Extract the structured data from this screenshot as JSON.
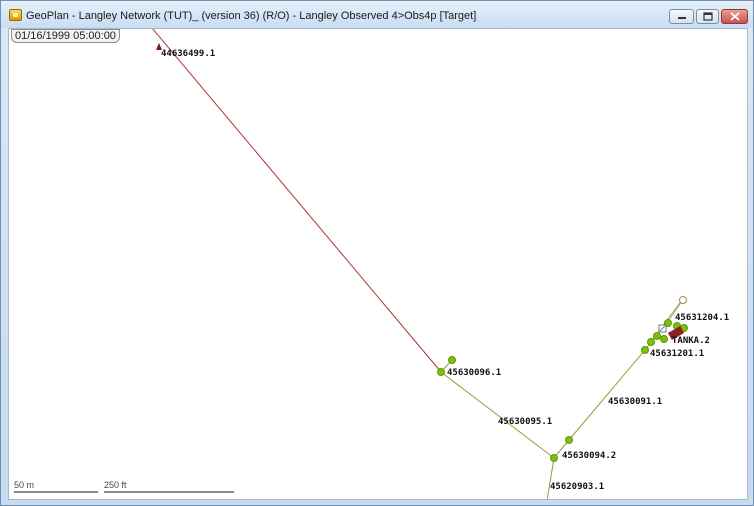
{
  "window": {
    "title": "GeoPlan - Langley Network (TUT)_ (version 36) (R/O) - Langley Observed 4>Obs4p  [Target]",
    "app_icon": "geoplan-app-icon",
    "controls": [
      "minimize-icon",
      "maximize-icon",
      "close-icon"
    ]
  },
  "map": {
    "timestamp": "01/16/1999 05:00:00",
    "scale_metric": "50 m",
    "scale_imperial": "250 ft",
    "colors": {
      "trunk_main": "#a83a34",
      "main": "#8fa03a",
      "node": "#7cbf0e",
      "node_outline": "#5c9a08"
    },
    "labels": {
      "n44636499": "44636499.1",
      "n45630096": "45630096.1",
      "p45630095": "45630095.1",
      "p45630091": "45630091.1",
      "n45630094": "45630094.2",
      "n45620903": "45620903.1",
      "n45631204": "45631204.1",
      "tanka": "TANKA.2",
      "n45631201": "45631201.1"
    }
  }
}
